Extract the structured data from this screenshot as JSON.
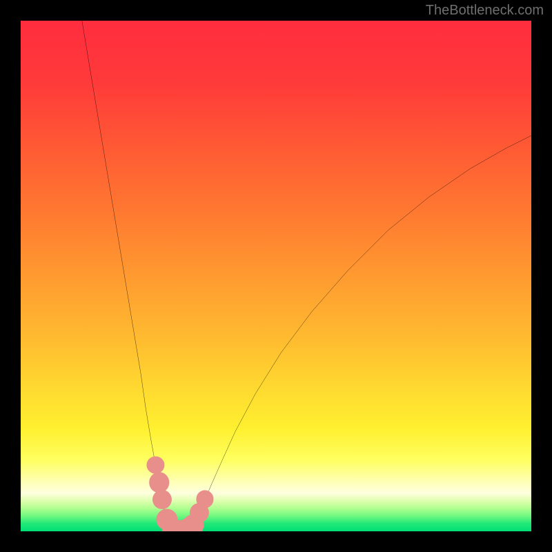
{
  "watermark": "TheBottleneck.com",
  "colors": {
    "frame": "#000000",
    "curve_stroke": "#000000",
    "marker_fill": "#e88f8c",
    "watermark_text": "#6f6f6f",
    "gradient_stops": [
      {
        "offset": 0.0,
        "color": "#ff2d3e"
      },
      {
        "offset": 0.12,
        "color": "#ff3a3a"
      },
      {
        "offset": 0.25,
        "color": "#ff5a34"
      },
      {
        "offset": 0.38,
        "color": "#ff7a31"
      },
      {
        "offset": 0.5,
        "color": "#ff9a30"
      },
      {
        "offset": 0.62,
        "color": "#ffba30"
      },
      {
        "offset": 0.72,
        "color": "#ffd930"
      },
      {
        "offset": 0.8,
        "color": "#fff030"
      },
      {
        "offset": 0.86,
        "color": "#ffff60"
      },
      {
        "offset": 0.9,
        "color": "#ffffb0"
      },
      {
        "offset": 0.925,
        "color": "#ffffe0"
      },
      {
        "offset": 0.94,
        "color": "#e0ffb0"
      },
      {
        "offset": 0.955,
        "color": "#b0ff90"
      },
      {
        "offset": 0.97,
        "color": "#70f880"
      },
      {
        "offset": 0.985,
        "color": "#20e878"
      },
      {
        "offset": 1.0,
        "color": "#00df75"
      }
    ]
  },
  "chart_data": {
    "type": "line",
    "title": "",
    "xlabel": "",
    "ylabel": "",
    "x_range": [
      0,
      100
    ],
    "y_range": [
      0,
      100
    ],
    "series": [
      {
        "name": "left-branch",
        "x": [
          12.0,
          14.0,
          16.0,
          18.0,
          20.0,
          22.0,
          23.5,
          24.5,
          25.5,
          26.5,
          27.2,
          27.8,
          28.3,
          28.8,
          29.2,
          29.5
        ],
        "y": [
          100.0,
          88.0,
          76.0,
          64.0,
          52.0,
          40.0,
          31.0,
          24.0,
          18.0,
          12.5,
          8.5,
          5.5,
          3.4,
          1.8,
          0.7,
          0.0
        ]
      },
      {
        "name": "valley-floor",
        "x": [
          29.5,
          30.5,
          31.5,
          32.5,
          33.5
        ],
        "y": [
          0.0,
          0.0,
          0.0,
          0.0,
          0.0
        ]
      },
      {
        "name": "right-branch",
        "x": [
          33.5,
          34.2,
          35.0,
          36.0,
          37.5,
          39.5,
          42.0,
          46.0,
          51.0,
          57.0,
          64.0,
          72.0,
          80.0,
          88.0,
          95.0,
          100.0
        ],
        "y": [
          0.0,
          1.5,
          3.5,
          6.0,
          9.5,
          14.0,
          19.5,
          27.0,
          35.0,
          43.0,
          51.0,
          59.0,
          65.5,
          71.0,
          75.0,
          77.5
        ]
      }
    ],
    "markers": [
      {
        "x": 26.4,
        "y": 13.0,
        "r": 1.7
      },
      {
        "x": 27.1,
        "y": 9.6,
        "r": 2.0
      },
      {
        "x": 27.7,
        "y": 6.2,
        "r": 1.9
      },
      {
        "x": 28.6,
        "y": 2.3,
        "r": 2.1
      },
      {
        "x": 29.8,
        "y": 0.3,
        "r": 2.2
      },
      {
        "x": 31.4,
        "y": 0.0,
        "r": 2.2
      },
      {
        "x": 32.9,
        "y": 0.4,
        "r": 2.2
      },
      {
        "x": 33.8,
        "y": 1.2,
        "r": 2.1
      },
      {
        "x": 35.0,
        "y": 3.6,
        "r": 1.9
      },
      {
        "x": 36.1,
        "y": 6.3,
        "r": 1.7
      }
    ]
  }
}
